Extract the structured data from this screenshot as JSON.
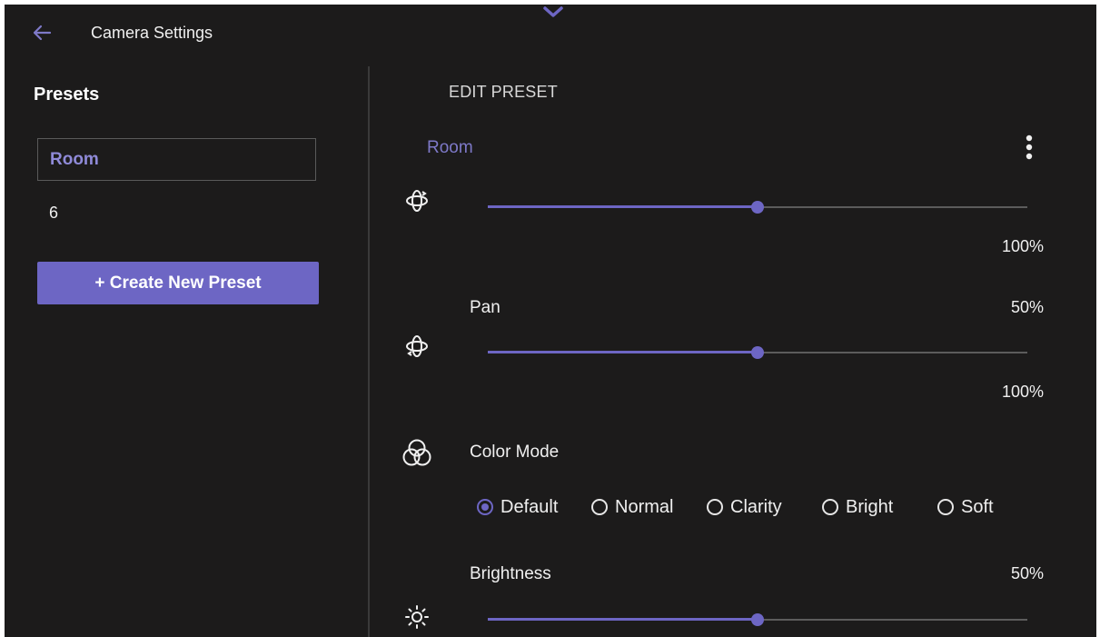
{
  "header": {
    "title": "Camera Settings",
    "back_icon": "arrow-left-icon",
    "collapse_icon": "chevron-down-icon"
  },
  "presets": {
    "heading": "Presets",
    "items": [
      {
        "label": "Room",
        "selected": true
      },
      {
        "label": "6",
        "selected": false
      }
    ],
    "create_button": "+ Create New Preset"
  },
  "editor": {
    "heading": "EDIT PRESET",
    "preset_name": "Room",
    "more_icon": "more-vertical-icon",
    "controls": [
      {
        "icon": "rotate-3d-icon",
        "label": "",
        "value_label": "",
        "bottom_label": "100%",
        "level": 0.5
      },
      {
        "icon": "rotate-3d-icon",
        "label": "Pan",
        "value_label": "50%",
        "bottom_label": "100%",
        "level": 0.5
      }
    ],
    "color_mode": {
      "icon": "color-circles-icon",
      "label": "Color Mode",
      "options": [
        "Default",
        "Normal",
        "Clarity",
        "Bright",
        "Soft"
      ],
      "selected": "Default"
    },
    "brightness": {
      "icon": "sun-icon",
      "label": "Brightness",
      "value_label": "50%",
      "level": 0.5
    }
  },
  "colors": {
    "accent": "#6d66c4",
    "background": "#1c1b1b",
    "selected_text": "#8f8ad8"
  }
}
